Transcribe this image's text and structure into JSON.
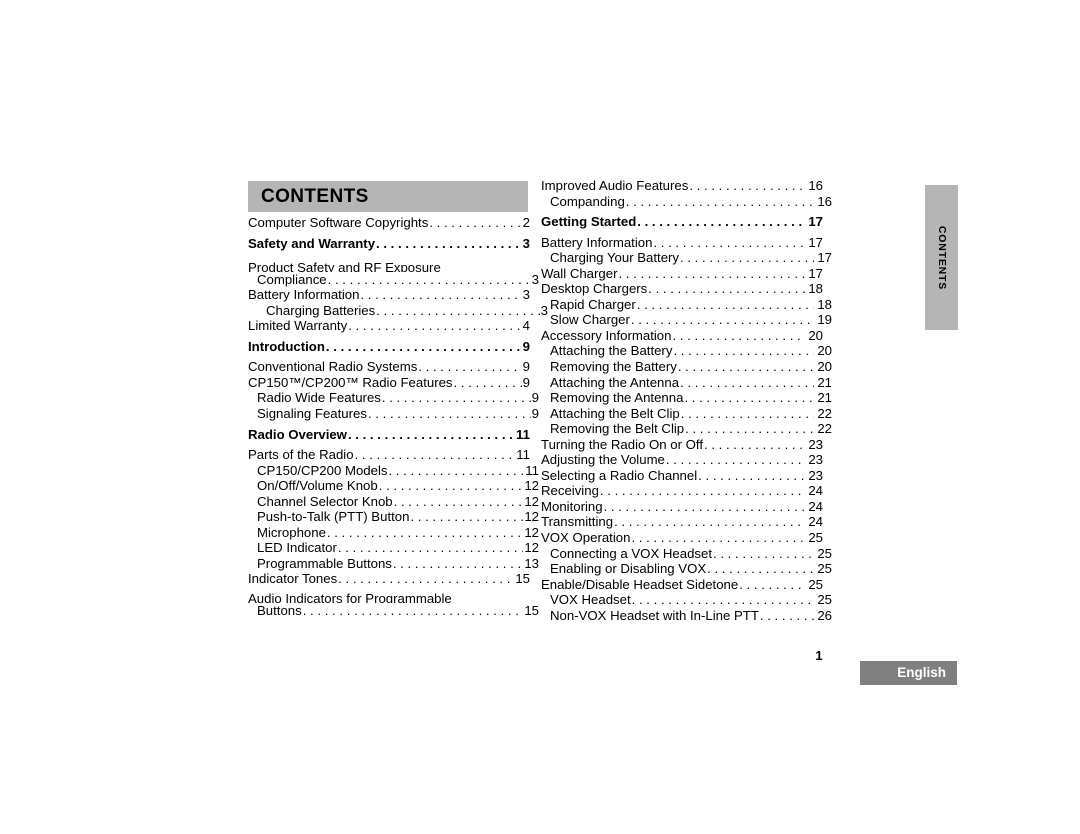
{
  "document": {
    "header_title": "CONTENTS",
    "side_tab_label": "CONTENTS",
    "page_number": "1",
    "language_badge": "English",
    "colors": {
      "header_band": "#b5b5b5",
      "side_tab": "#b5b5b5",
      "language_badge": "#808080",
      "page_background": "#ffffff",
      "text": "#000000"
    }
  },
  "toc": {
    "left_column": [
      {
        "label": "Computer Software Copyrights",
        "page": "2",
        "indent": 0,
        "bold": false,
        "leader": true
      },
      {
        "label": "Safety and Warranty",
        "page": "3",
        "indent": 0,
        "bold": true,
        "leader": true
      },
      {
        "label": "Product Safety and RF Exposure",
        "page": "",
        "indent": 0,
        "bold": false,
        "leader": false
      },
      {
        "label": "Compliance",
        "page": "3",
        "indent": 1,
        "bold": false,
        "leader": true
      },
      {
        "label": "Battery Information",
        "page": "3",
        "indent": 0,
        "bold": false,
        "leader": true
      },
      {
        "label": "Charging Batteries",
        "page": "3",
        "indent": 2,
        "bold": false,
        "leader": true
      },
      {
        "label": "Limited Warranty",
        "page": "4",
        "indent": 0,
        "bold": false,
        "leader": true
      },
      {
        "label": "Introduction",
        "page": "9",
        "indent": 0,
        "bold": true,
        "leader": true
      },
      {
        "label": "Conventional Radio Systems",
        "page": "9",
        "indent": 0,
        "bold": false,
        "leader": true
      },
      {
        "label": "CP150™/CP200™ Radio Features",
        "page": "9",
        "indent": 0,
        "bold": false,
        "leader": true
      },
      {
        "label": "Radio Wide Features",
        "page": "9",
        "indent": 1,
        "bold": false,
        "leader": true
      },
      {
        "label": "Signaling Features",
        "page": "9",
        "indent": 1,
        "bold": false,
        "leader": true
      },
      {
        "label": "Radio Overview",
        "page": "11",
        "indent": 0,
        "bold": true,
        "leader": true
      },
      {
        "label": "Parts of the Radio",
        "page": "11",
        "indent": 0,
        "bold": false,
        "leader": true
      },
      {
        "label": "CP150/CP200 Models",
        "page": "11",
        "indent": 1,
        "bold": false,
        "leader": true
      },
      {
        "label": "On/Off/Volume Knob",
        "page": "12",
        "indent": 1,
        "bold": false,
        "leader": true
      },
      {
        "label": "Channel Selector Knob",
        "page": "12",
        "indent": 1,
        "bold": false,
        "leader": true
      },
      {
        "label": "Push-to-Talk (PTT) Button",
        "page": "12",
        "indent": 1,
        "bold": false,
        "leader": true
      },
      {
        "label": "Microphone",
        "page": "12",
        "indent": 1,
        "bold": false,
        "leader": true
      },
      {
        "label": "LED Indicator",
        "page": "12",
        "indent": 1,
        "bold": false,
        "leader": true
      },
      {
        "label": "Programmable Buttons",
        "page": "13",
        "indent": 1,
        "bold": false,
        "leader": true
      },
      {
        "label": "Indicator Tones",
        "page": "15",
        "indent": 0,
        "bold": false,
        "leader": true
      },
      {
        "label": "Audio Indicators for Programmable",
        "page": "",
        "indent": 0,
        "bold": false,
        "leader": false
      },
      {
        "label": "Buttons",
        "page": "15",
        "indent": 1,
        "bold": false,
        "leader": true
      }
    ],
    "right_column": [
      {
        "label": "Improved Audio Features",
        "page": "16",
        "indent": 0,
        "bold": false,
        "leader": true
      },
      {
        "label": "Companding",
        "page": "16",
        "indent": 1,
        "bold": false,
        "leader": true
      },
      {
        "label": "Getting Started",
        "page": "17",
        "indent": 0,
        "bold": true,
        "leader": true
      },
      {
        "label": "Battery Information",
        "page": "17",
        "indent": 0,
        "bold": false,
        "leader": true
      },
      {
        "label": "Charging Your Battery",
        "page": "17",
        "indent": 1,
        "bold": false,
        "leader": true
      },
      {
        "label": "Wall Charger",
        "page": "17",
        "indent": 0,
        "bold": false,
        "leader": true
      },
      {
        "label": "Desktop Chargers",
        "page": "18",
        "indent": 0,
        "bold": false,
        "leader": true
      },
      {
        "label": "Rapid Charger",
        "page": "18",
        "indent": 1,
        "bold": false,
        "leader": true
      },
      {
        "label": "Slow Charger",
        "page": "19",
        "indent": 1,
        "bold": false,
        "leader": true
      },
      {
        "label": "Accessory Information",
        "page": "20",
        "indent": 0,
        "bold": false,
        "leader": true
      },
      {
        "label": "Attaching the Battery",
        "page": "20",
        "indent": 1,
        "bold": false,
        "leader": true
      },
      {
        "label": "Removing the Battery",
        "page": "20",
        "indent": 1,
        "bold": false,
        "leader": true
      },
      {
        "label": "Attaching the Antenna",
        "page": "21",
        "indent": 1,
        "bold": false,
        "leader": true
      },
      {
        "label": "Removing the Antenna",
        "page": "21",
        "indent": 1,
        "bold": false,
        "leader": true
      },
      {
        "label": "Attaching the Belt Clip",
        "page": "22",
        "indent": 1,
        "bold": false,
        "leader": true
      },
      {
        "label": "Removing the Belt Clip",
        "page": "22",
        "indent": 1,
        "bold": false,
        "leader": true
      },
      {
        "label": "Turning the Radio On or Off",
        "page": "23",
        "indent": 0,
        "bold": false,
        "leader": true
      },
      {
        "label": "Adjusting the Volume",
        "page": "23",
        "indent": 0,
        "bold": false,
        "leader": true
      },
      {
        "label": "Selecting a Radio Channel",
        "page": "23",
        "indent": 0,
        "bold": false,
        "leader": true
      },
      {
        "label": "Receiving",
        "page": "24",
        "indent": 0,
        "bold": false,
        "leader": true
      },
      {
        "label": "Monitoring",
        "page": "24",
        "indent": 0,
        "bold": false,
        "leader": true
      },
      {
        "label": "Transmitting",
        "page": "24",
        "indent": 0,
        "bold": false,
        "leader": true
      },
      {
        "label": "VOX Operation",
        "page": "25",
        "indent": 0,
        "bold": false,
        "leader": true
      },
      {
        "label": "Connecting a VOX Headset",
        "page": "25",
        "indent": 1,
        "bold": false,
        "leader": true
      },
      {
        "label": "Enabling or Disabling VOX",
        "page": "25",
        "indent": 1,
        "bold": false,
        "leader": true
      },
      {
        "label": "Enable/Disable Headset Sidetone",
        "page": "25",
        "indent": 0,
        "bold": false,
        "leader": true
      },
      {
        "label": "VOX Headset",
        "page": "25",
        "indent": 1,
        "bold": false,
        "leader": true
      },
      {
        "label": "Non-VOX Headset with In-Line PTT",
        "page": "26",
        "indent": 1,
        "bold": false,
        "leader": true
      }
    ]
  }
}
